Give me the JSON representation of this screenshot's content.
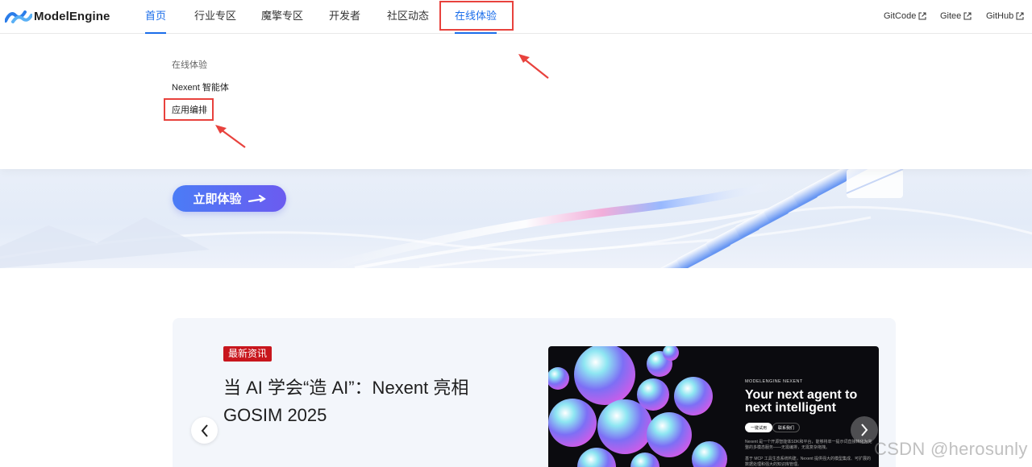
{
  "header": {
    "logo_text": "ModelEngine",
    "nav": [
      {
        "label": "首页"
      },
      {
        "label": "行业专区"
      },
      {
        "label": "魔擎专区"
      },
      {
        "label": "开发者"
      },
      {
        "label": "社区动态"
      },
      {
        "label": "在线体验"
      }
    ],
    "active_nav": "首页",
    "external_links": [
      {
        "label": "GitCode"
      },
      {
        "label": "Gitee"
      },
      {
        "label": "GitHub"
      }
    ]
  },
  "dropdown": {
    "title": "在线体验",
    "items": [
      {
        "label": "Nexent 智能体"
      },
      {
        "label": "应用编排"
      }
    ]
  },
  "banner": {
    "cta_label": "立即体验"
  },
  "news": {
    "badge": "最新资讯",
    "title": "当 AI 学会“造 AI”：Nexent 亮相 GOSIM 2025",
    "image": {
      "eyebrow": "MODELENGINE NEXENT",
      "headline": "Your next agent to next intelligent",
      "pill_primary": "一键试用",
      "pill_secondary": "联系我们",
      "body_1": "Nexent 是一个开源智能体SDK和平台，能够将单一提示词直接转化为完整的多模态服务——无需编排，无需复杂拖拽。",
      "body_2": "基于 MCP 工具生态系统构建，Nexent 提供强大的模型集成、可扩展的数据处理和强大的知识库管理。"
    }
  },
  "colors": {
    "brand_blue": "#1a6dea",
    "badge_red": "#c8161d",
    "highlight_red": "#e8423d"
  },
  "watermark": "CSDN @herosunly"
}
